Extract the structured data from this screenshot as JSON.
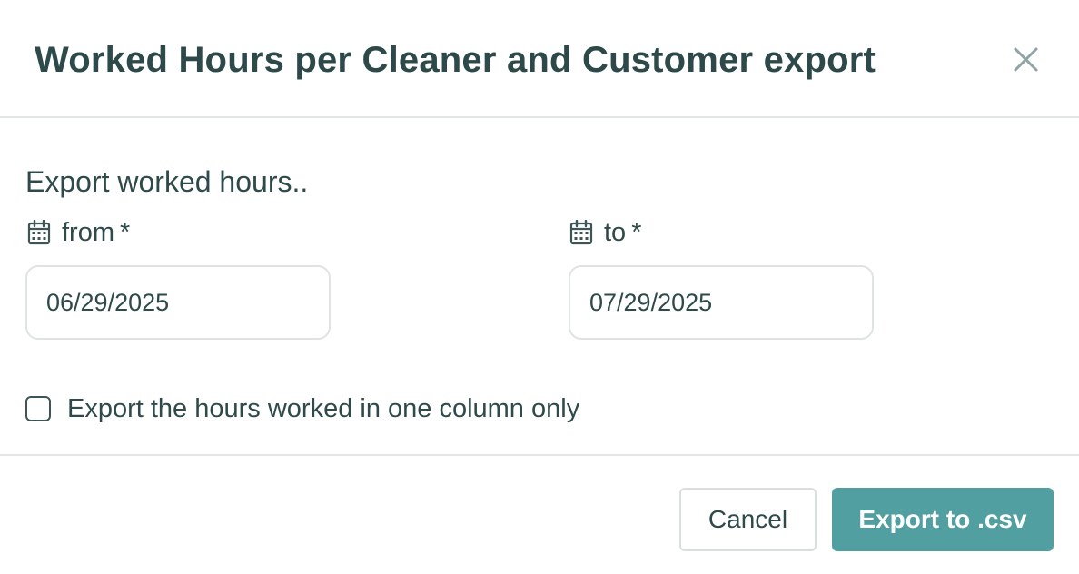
{
  "dialog": {
    "title": "Worked Hours per Cleaner and Customer export",
    "close_icon": "close-icon"
  },
  "form": {
    "intro": "Export worked hours..",
    "from": {
      "label": "from",
      "required_mark": "*",
      "icon": "calendar-icon",
      "value": "06/29/2025"
    },
    "to": {
      "label": "to",
      "required_mark": "*",
      "icon": "calendar-icon",
      "value": "07/29/2025"
    },
    "single_column_checkbox": {
      "label": "Export the hours worked in one column only",
      "checked": false
    }
  },
  "footer": {
    "cancel_label": "Cancel",
    "export_label": "Export to .csv"
  },
  "colors": {
    "text": "#2f4a4a",
    "primary": "#529fa2",
    "divider": "#e3e6e6"
  }
}
